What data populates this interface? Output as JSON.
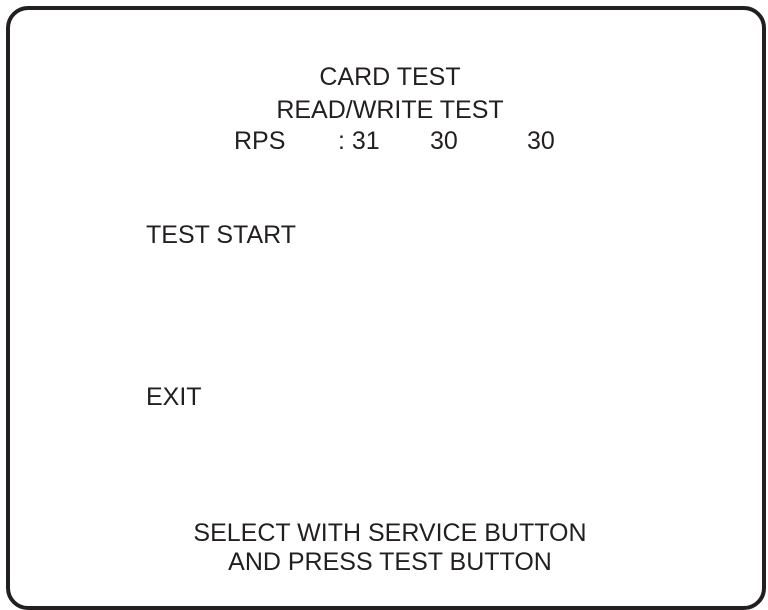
{
  "screen": {
    "title": "CARD TEST",
    "subtitle": "READ/WRITE TEST",
    "rps": {
      "label": "RPS",
      "separator": ": 31",
      "value_2": "30",
      "value_3": "30"
    },
    "menu": {
      "items": [
        {
          "label": "TEST START"
        },
        {
          "label": "EXIT"
        }
      ]
    },
    "footer": {
      "line1": "SELECT WITH SERVICE BUTTON",
      "line2": "AND PRESS TEST BUTTON"
    }
  }
}
